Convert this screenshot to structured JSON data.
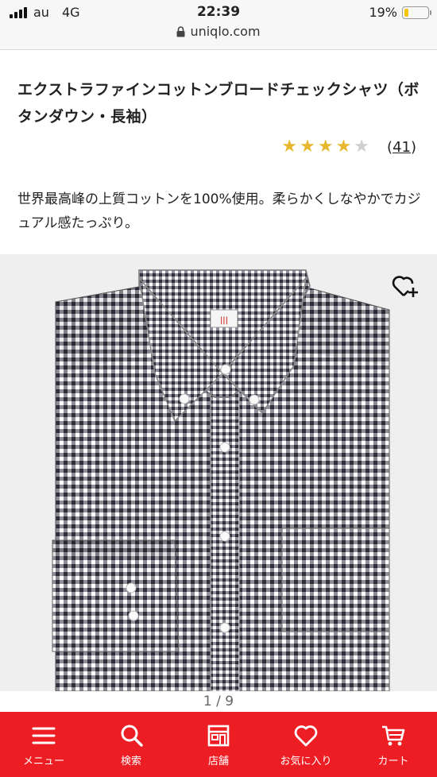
{
  "status_bar": {
    "carrier": "au",
    "network": "4G",
    "time": "22:39",
    "url": "uniqlo.com",
    "battery_percent": "19%",
    "battery_level": 0.19
  },
  "product": {
    "title": "エクストラファインコットンブロードチェックシャツ（ボタンダウン・長袖）",
    "rating": 4,
    "rating_max": 5,
    "review_count": "41",
    "description": "世界最高峰の上質コットンを100%使用。柔らかくしなやかでカジュアル感たっぷり。"
  },
  "gallery": {
    "pager": "1 / 9",
    "shirt_label": "UNIQLO",
    "shirt_size": "L",
    "colors": {
      "check_dark": "#2f2f3a",
      "background": "#efeff0"
    }
  },
  "bottom_nav": {
    "items": [
      {
        "label": "メニュー",
        "icon": "menu-icon"
      },
      {
        "label": "検索",
        "icon": "search-icon"
      },
      {
        "label": "店舗",
        "icon": "store-icon"
      },
      {
        "label": "お気に入り",
        "icon": "heart-icon"
      },
      {
        "label": "カート",
        "icon": "cart-icon"
      }
    ],
    "color": "#ed1d24"
  }
}
